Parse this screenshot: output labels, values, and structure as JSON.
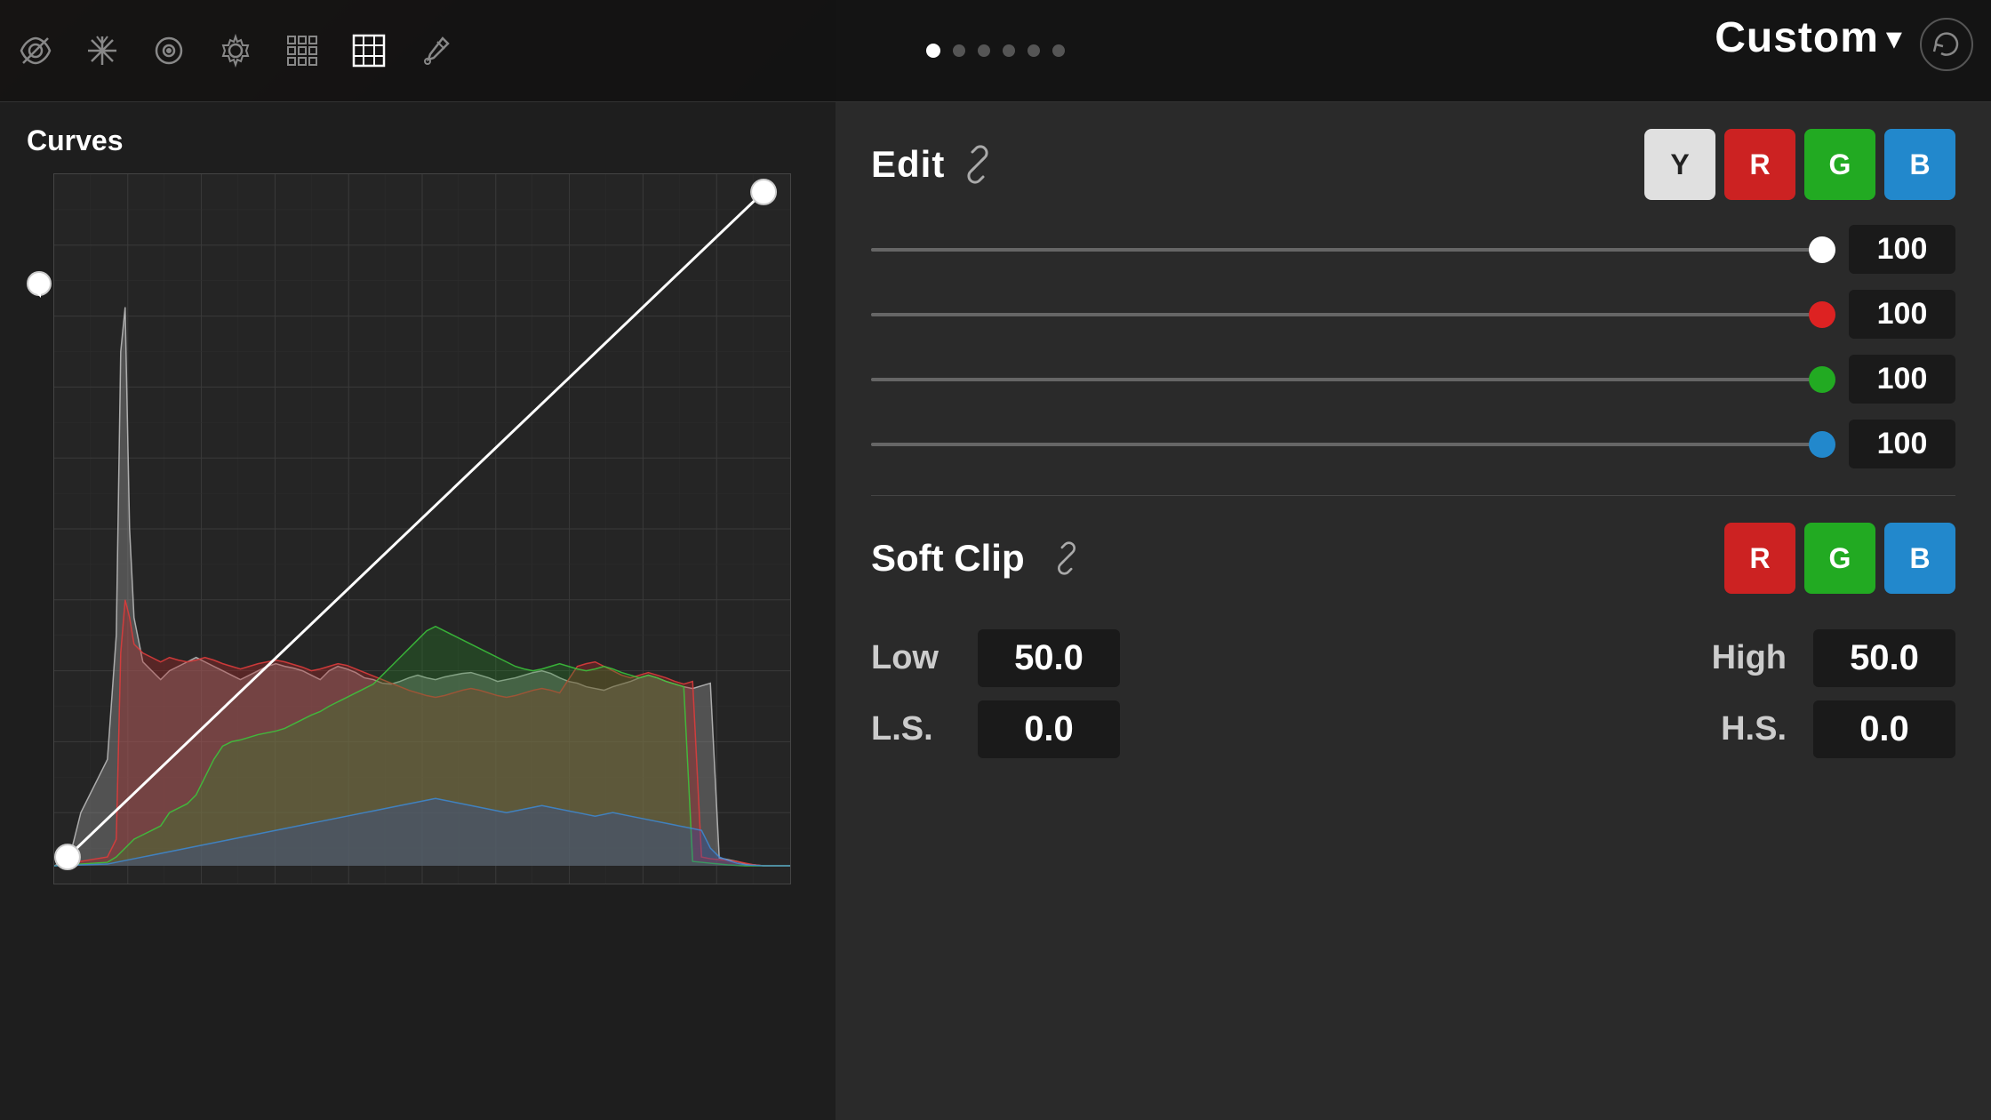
{
  "toolbar": {
    "custom_label": "Custom",
    "chevron": "▾",
    "reset_tooltip": "Reset"
  },
  "pagination": {
    "dots": [
      true,
      false,
      false,
      false,
      false,
      false
    ],
    "active_index": 0
  },
  "curves": {
    "label": "Curves"
  },
  "edit": {
    "title": "Edit",
    "channels": {
      "y_label": "Y",
      "r_label": "R",
      "g_label": "G",
      "b_label": "B"
    },
    "sliders": [
      {
        "id": "white",
        "value": "100",
        "color": "#ffffff",
        "percent": 100
      },
      {
        "id": "red",
        "value": "100",
        "color": "#dd2222",
        "percent": 100
      },
      {
        "id": "green",
        "value": "100",
        "color": "#22aa22",
        "percent": 100
      },
      {
        "id": "blue",
        "value": "100",
        "color": "#2288cc",
        "percent": 100
      }
    ]
  },
  "soft_clip": {
    "title": "Soft Clip",
    "channels": {
      "r_label": "R",
      "g_label": "G",
      "b_label": "B"
    },
    "low_label": "Low",
    "high_label": "High",
    "ls_label": "L.S.",
    "hs_label": "H.S.",
    "low_value": "50.0",
    "high_value": "50.0",
    "ls_value": "0.0",
    "hs_value": "0.0"
  }
}
